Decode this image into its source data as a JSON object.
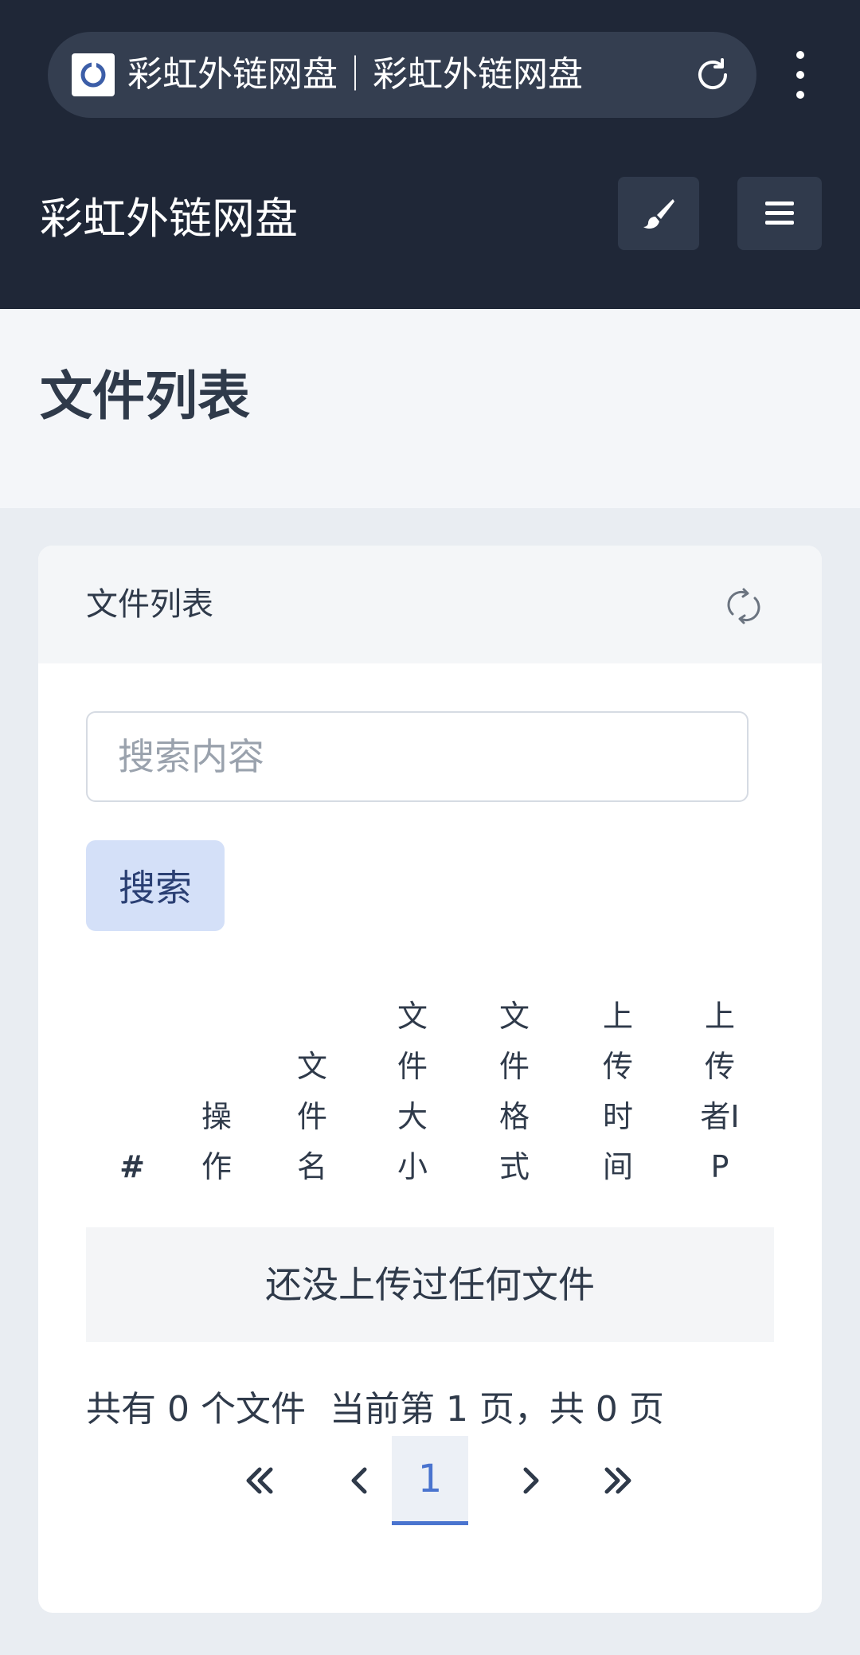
{
  "browser": {
    "tab_title": "彩虹外链网盘｜彩虹外链网盘"
  },
  "header": {
    "app_title": "彩虹外链网盘"
  },
  "page": {
    "title": "文件列表"
  },
  "card": {
    "title": "文件列表",
    "search": {
      "placeholder": "搜索内容",
      "value": "",
      "button_label": "搜索"
    },
    "table": {
      "columns": [
        "#",
        "操作",
        "文件名",
        "文件大小",
        "文件格式",
        "上传时间",
        "上传者IP"
      ],
      "empty_message": "还没上传过任何文件"
    },
    "summary": {
      "total_files": "共有 0 个文件",
      "page_info": "当前第 1 页，共 0 页"
    },
    "pagination": {
      "current_page": "1"
    }
  },
  "colors": {
    "header_bg": "#1f2737",
    "accent": "#4a74cf",
    "search_button_bg": "#d4e0f8"
  }
}
